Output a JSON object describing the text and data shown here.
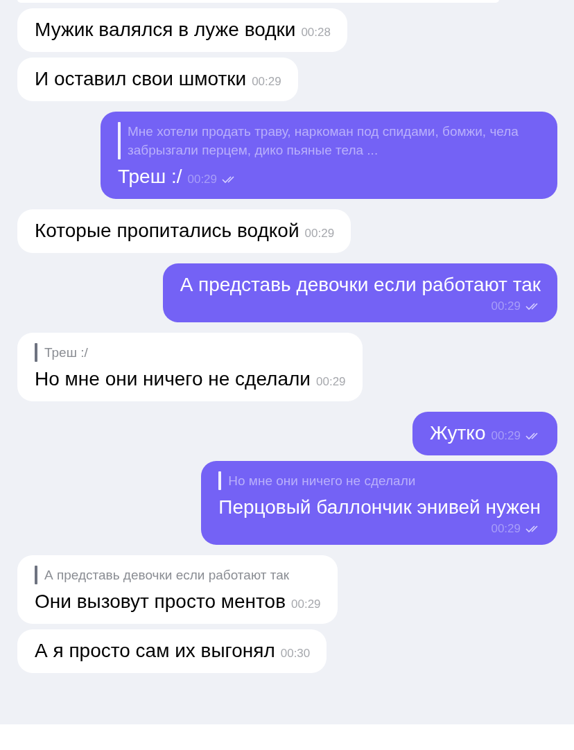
{
  "messages": [
    {
      "kind": "incoming",
      "text": "Мужик валялся в луже водки",
      "time": "00:28",
      "read": false
    },
    {
      "kind": "incoming",
      "text": "И оставил свои шмотки",
      "time": "00:29",
      "read": false
    },
    {
      "kind": "outgoing",
      "quote": "Мне хотели продать траву, наркоман под спидами, бомжи, чела забрызгали перцем, дико пьяные тела ...",
      "text": "Треш :/",
      "time": "00:29",
      "read": true
    },
    {
      "kind": "incoming",
      "text": "Которые пропитались водкой",
      "time": "00:29",
      "read": false
    },
    {
      "kind": "stacked",
      "text": "А представь девочки если работают так",
      "time": "00:29",
      "read": true
    },
    {
      "kind": "incoming",
      "quote": "Треш :/",
      "text": "Но мне они ничего не сделали",
      "time": "00:29",
      "read": false
    },
    {
      "kind": "outgoing",
      "text": "Жутко",
      "time": "00:29",
      "read": true
    },
    {
      "kind": "stacked",
      "quote": "Но мне они ничего не сделали",
      "text": "Перцовый баллончик энивей нужен",
      "time": "00:29",
      "read": true
    },
    {
      "kind": "incoming",
      "quote": "А представь девочки если работают так",
      "text": "Они вызовут просто ментов",
      "time": "00:29",
      "read": false
    },
    {
      "kind": "incoming",
      "text": "А я просто сам их выгонял",
      "time": "00:30",
      "read": false
    }
  ]
}
